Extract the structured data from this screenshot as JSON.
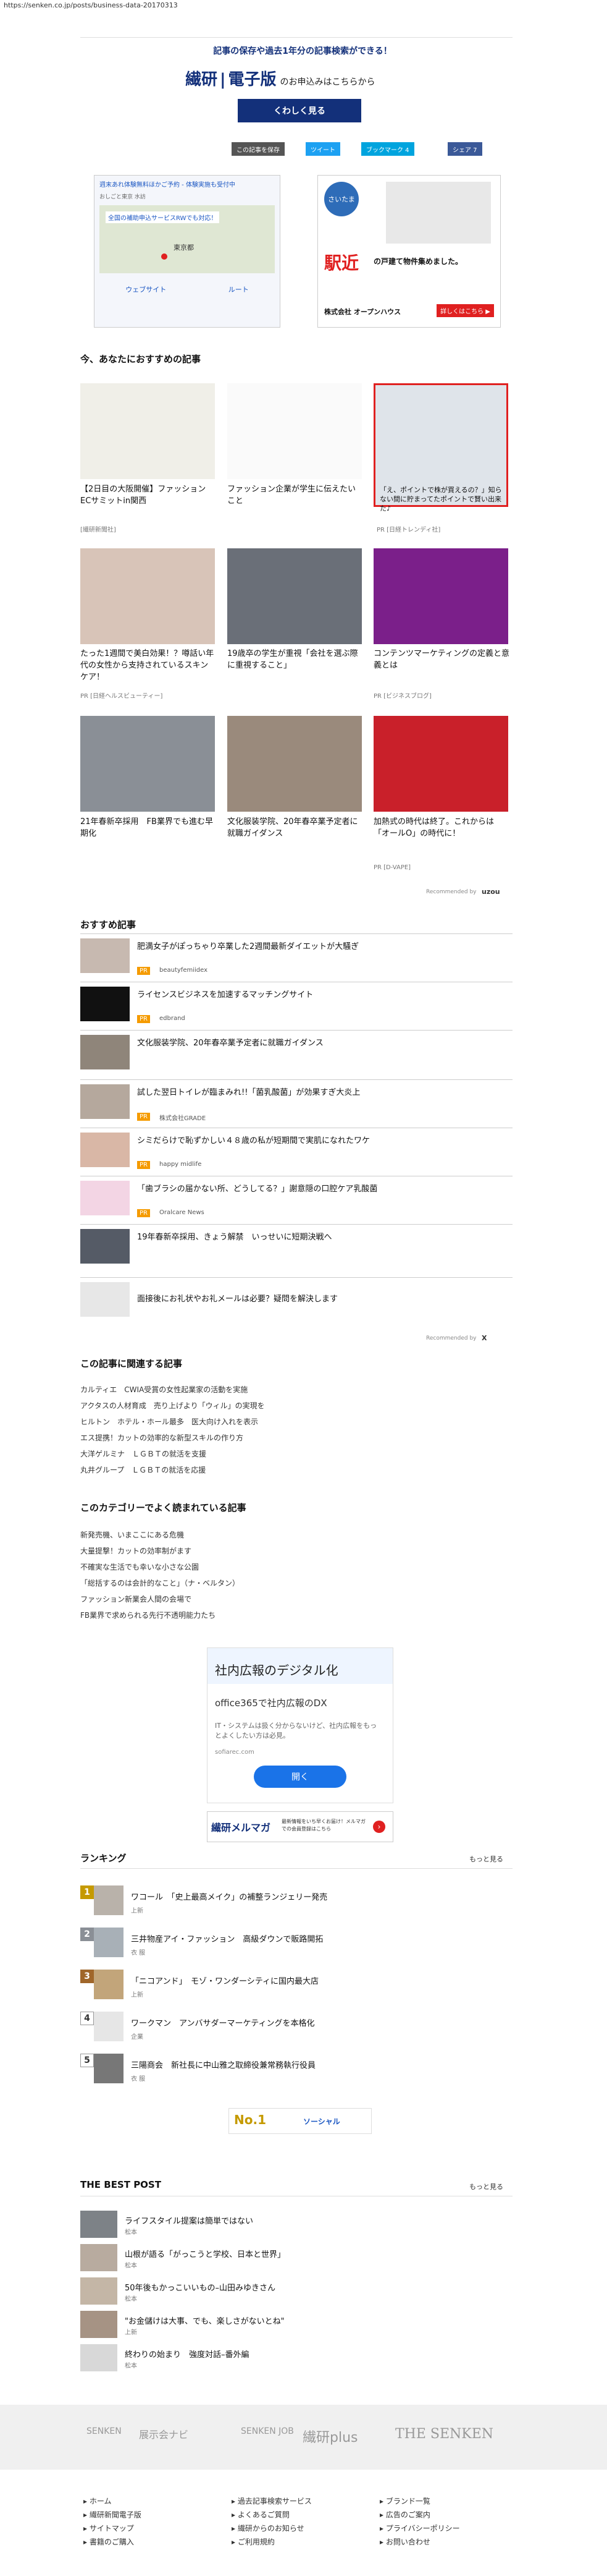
{
  "url": "https://senken.co.jp/posts/business-data-20170313",
  "promo": {
    "headline": "記事の保存や過去1年分の記事検索ができる！",
    "logo": "繊研",
    "logo_sub": "電子版",
    "logo_suffix": "のお申込みはこちらから",
    "button": "くわしく見る"
  },
  "share_buttons": [
    "この記事を保存",
    "ツイート",
    "ブックマーク 4",
    "シェア 7"
  ],
  "ads": {
    "map": {
      "line1": "週末あれ体験無料ほかご予約 - 体験実施も受付中",
      "line2": "おしごと東京 水訪",
      "line3": "全国の補助申込サービスRWでも対応！",
      "station": "東京都",
      "btn_site": "ウェブサイト",
      "btn_route": "ルート"
    },
    "house": {
      "badge": "さいたま",
      "big": "駅近",
      "line": "の戸建て物件集めました。",
      "company": "株式会社 オープンハウス",
      "cta": "詳しくはこちら ▶"
    }
  },
  "recommended": {
    "title": "今、あなたにおすすめの記事",
    "cards": [
      {
        "title": "【2日目の大阪開催】ファッションECサミットin関西",
        "src": "[繊研新聞社]"
      },
      {
        "title": "ファッション企業が学生に伝えたいこと",
        "src": ""
      },
      {
        "title": "「え、ポイントで株が買えるの？」知らない間に貯まってたポイントで賢い出来た♪",
        "src": "PR [日経トレンディ社]"
      },
      {
        "title": "たった1週間で美白効果！？噂話い年代の女性から支持されているスキンケア！",
        "src": "PR [日経ヘルスビューティー]"
      },
      {
        "title": "19歳卒の学生が重視「会社を選ぶ際に重視すること」",
        "src": ""
      },
      {
        "title": "コンテンツマーケティングの定義と意義とは",
        "src": "PR [ビジネスブログ]"
      },
      {
        "title": "21年春新卒採用　FB業界でも進む早期化",
        "src": ""
      },
      {
        "title": "文化服装学院、20年春卒業予定者に就職ガイダンス",
        "src": ""
      },
      {
        "title": "加熱式の時代は終了。これからは「オールO」の時代に！",
        "src": "PR [D-VAPE]"
      }
    ],
    "recommended_by": "Recommended by"
  },
  "osusume": {
    "title": "おすすめ記事",
    "items": [
      {
        "title": "肥満女子がぽっちゃり卒業した2週間最新ダイエットが大騒ぎ",
        "badge": "PR",
        "src": "beautyfemiidex"
      },
      {
        "title": "ライセンスビジネスを加速するマッチングサイト",
        "badge": "PR",
        "src": "edbrand"
      },
      {
        "title": "文化服装学院、20年春卒業予定者に就職ガイダンス",
        "badge": "",
        "src": ""
      },
      {
        "title": "試した翌日トイレが臨まみれ!!「菌乳酸菌」が効果すぎ大炎上",
        "badge": "PR",
        "src": "株式会社GRADE"
      },
      {
        "title": "シミだらけで恥ずかしい４８歳の私が短期間で実肌になれたワケ",
        "badge": "PR",
        "src": "happy midlife"
      },
      {
        "title": "「歯ブラシの届かない所、どうしてる？」謝意隠の口腔ケア乳酸菌",
        "badge": "PR",
        "src": "Oralcare News"
      },
      {
        "title": "19年春新卒採用、きょう解禁　いっせいに短期決戦へ",
        "badge": "",
        "src": ""
      },
      {
        "title": "面接後にお礼状やお礼メールは必要？疑問を解決します",
        "badge": "",
        "src": ""
      }
    ],
    "recommended_by": "Recommended by"
  },
  "related": {
    "title": "この記事に関連する記事",
    "links": [
      "カルティエ　CWIA受賞の女性起業家の活動を実施",
      "アクタスの人材育成　売り上げより「ウィル」の実現を",
      "ヒルトン　ホテル・ホール最多　医大向け入れを表示",
      "エス提携！カットの効率的な新型スキルの作り方",
      "大洋ゲルミナ　ＬＧＢＴの就活を支援",
      "丸井グループ　ＬＧＢＴの就活を応援"
    ]
  },
  "category": {
    "title": "このカテゴリーでよく読まれている記事",
    "links": [
      "新発売機、いまここにある危機",
      "大量提撃！カットの効率制がます",
      "不確実な生活でも幸いな小さな公園",
      "「総括するのは会計的なこと」（ナ・ベルタン）",
      "ファッション新業会人間の会場で",
      "FB業界で求められる先行不透明能力たち"
    ]
  },
  "ad_box": {
    "headline": "社内広報のデジタル化",
    "sub": "office365で社内広報のDX",
    "desc": "IT・システムは扱く分からないけど、社内広報をもっとよくしたい方は必見。",
    "domain": "sofiarec.com",
    "button": "開く"
  },
  "mail_banner": {
    "text": "繊研メルマガ",
    "sub": "最新情報をいち早くお届け！メルマガでの会員登録はこちら"
  },
  "ranking": {
    "title": "ランキング",
    "more": "もっと見る",
    "items": [
      {
        "rank": "1",
        "title": "ワコール　「史上最高メイク」の補整ランジェリー発売",
        "sub": "上新"
      },
      {
        "rank": "2",
        "title": "三井物産アイ・ファッション　高級ダウンで販路開拓",
        "sub": "衣 服"
      },
      {
        "rank": "3",
        "title": "「ニコアンド」　モゾ・ワンダーシティに国内最大店",
        "sub": "上新"
      },
      {
        "rank": "4",
        "title": "ワークマン　アンバサダーマーケティングを本格化",
        "sub": "企業"
      },
      {
        "rank": "5",
        "title": "三陽商会　新社長に中山雅之取締役兼常務執行役員",
        "sub": "衣 服"
      }
    ],
    "banner_left": "No.1",
    "banner_right": "ソーシャル"
  },
  "best_post": {
    "title": "THE BEST POST",
    "more": "もっと見る",
    "items": [
      {
        "title": "ライフスタイル提案は簡単ではない",
        "sub": "松本"
      },
      {
        "title": "山根が語る「がっこうと学校、日本と世界」",
        "sub": "松本"
      },
      {
        "title": "50年後もかっこいいもの–山田みゆきさん",
        "sub": "松本"
      },
      {
        "title": "\"お金儲けは大事、でも、楽しさがないとね\"",
        "sub": "上新"
      },
      {
        "title": "終わりの始まり　強度対話–番外編",
        "sub": "松本"
      }
    ]
  },
  "footer_logos": [
    "SENKEN",
    "展示会ナビ",
    "SENKEN JOB",
    "繊研plus",
    "THE SENKEN"
  ],
  "footer_links": {
    "col1": [
      "ホーム",
      "繊研新聞電子版",
      "サイトマップ",
      "書籍のご購入"
    ],
    "col2": [
      "過去記事検索サービス",
      "よくあるご質問",
      "繊研からのお知らせ",
      "ご利用規約"
    ],
    "col3": [
      "ブランド一覧",
      "広告のご案内",
      "プライバシーポリシー",
      "お問い合わせ"
    ]
  },
  "colors": {
    "navy": "#13307a",
    "twitter": "#1da1f2",
    "hatena": "#00a4de",
    "facebook": "#3b5998",
    "orange": "#f59b00",
    "red": "#e02020"
  }
}
